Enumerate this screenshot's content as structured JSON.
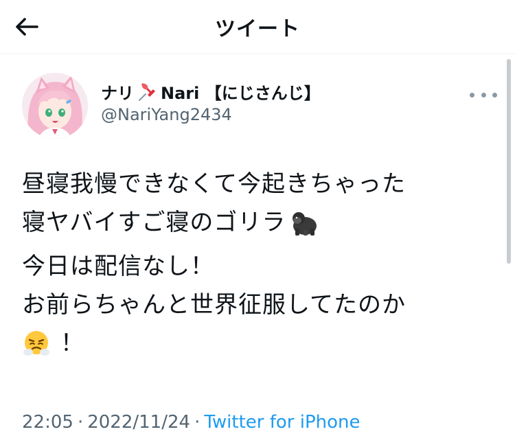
{
  "header": {
    "title": "ツイート",
    "back_icon": "arrow-left-icon"
  },
  "author": {
    "name_prefix": "ナリ",
    "name_icon": "pushpin-icon",
    "name_suffix": "Nari 【にじさんじ】",
    "handle": "@NariYang2434",
    "more_icon": "more-horizontal-icon"
  },
  "tweet": {
    "paragraph1": {
      "line1": "昼寝我慢できなくて今起きちゃった",
      "line2": "寝ヤバイすご寝のゴリラ",
      "line2_emoji": "gorilla-emoji"
    },
    "paragraph2": {
      "line1": "今日は配信なし！",
      "line2": "お前らちゃんと世界征服してたのか",
      "line3_emoji": "face-with-steam-emoji",
      "line3": "！"
    }
  },
  "meta": {
    "time": "22:05",
    "separator": "·",
    "date": "2022/11/24",
    "source": "Twitter for iPhone"
  },
  "colors": {
    "text": "#0f1419",
    "secondary": "#536471",
    "link": "#1d9bf0"
  }
}
